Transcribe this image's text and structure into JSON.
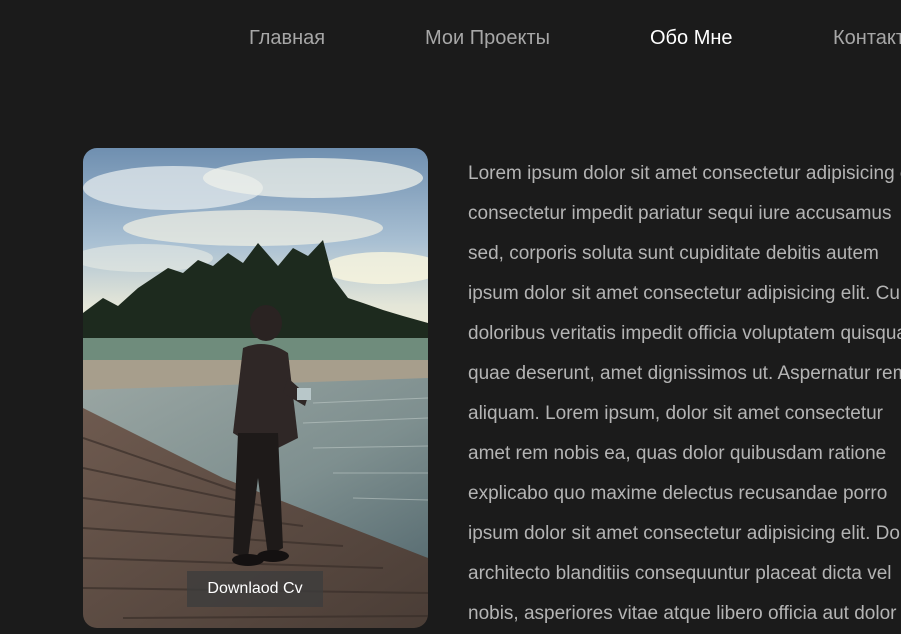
{
  "nav": {
    "items": [
      {
        "label": "Главная",
        "active": false
      },
      {
        "label": "Мои Проекты",
        "active": false
      },
      {
        "label": "Обо Мне",
        "active": true
      },
      {
        "label": "Контакты",
        "active": false
      }
    ]
  },
  "profile": {
    "cv_button_label": "Downlaod Cv"
  },
  "about": {
    "lines": [
      "Lorem ipsum dolor sit amet consectetur adipisicing elit.",
      "consectetur impedit pariatur sequi iure accusamus",
      "sed, corporis soluta sunt cupiditate debitis autem",
      "ipsum dolor sit amet consectetur adipisicing elit. Cum",
      "doloribus veritatis impedit officia voluptatem quisquam",
      "quae deserunt, amet dignissimos ut. Aspernatur rem",
      "aliquam. Lorem ipsum, dolor sit amet consectetur",
      "amet rem nobis ea, quas dolor quibusdam ratione",
      "explicabo quo maxime delectus recusandae porro",
      "ipsum dolor sit amet consectetur adipisicing elit. Dolor",
      "architecto blanditiis consequuntur placeat dicta vel",
      "nobis, asperiores vitae atque libero officia aut dolor"
    ]
  },
  "colors": {
    "background": "#1b1b1b",
    "nav_inactive": "#a7a7a7",
    "nav_active": "#ffffff",
    "body_text": "#b4b4b4"
  }
}
